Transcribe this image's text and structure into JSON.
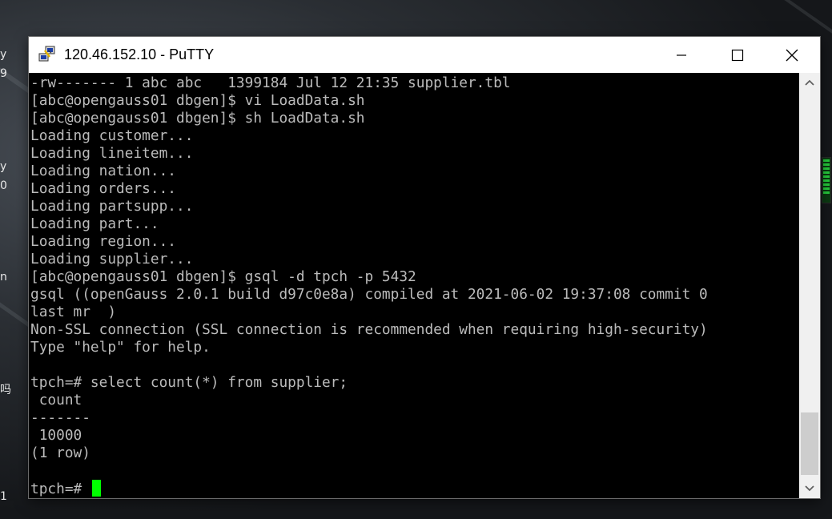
{
  "window": {
    "title": "120.46.152.10 - PuTTY",
    "app_icon": "putty-icon",
    "controls": {
      "minimize": "minimize-icon",
      "maximize": "maximize-icon",
      "close": "close-icon"
    }
  },
  "terminal": {
    "lines": [
      "-rw------- 1 abc abc   1399184 Jul 12 21:35 supplier.tbl",
      "[abc@opengauss01 dbgen]$ vi LoadData.sh",
      "[abc@opengauss01 dbgen]$ sh LoadData.sh",
      "Loading customer...",
      "Loading lineitem...",
      "Loading nation...",
      "Loading orders...",
      "Loading partsupp...",
      "Loading part...",
      "Loading region...",
      "Loading supplier...",
      "[abc@opengauss01 dbgen]$ gsql -d tpch -p 5432",
      "gsql ((openGauss 2.0.1 build d97c0e8a) compiled at 2021-06-02 19:37:08 commit 0",
      "last mr  )",
      "Non-SSL connection (SSL connection is recommended when requiring high-security)",
      "Type \"help\" for help.",
      "",
      "tpch=# select count(*) from supplier;",
      " count",
      "-------",
      " 10000",
      "(1 row)",
      ""
    ],
    "prompt": "tpch=# ",
    "cursor_color": "#00ff00",
    "text_color": "#bbbbbb",
    "background": "#000000"
  },
  "scrollbar": {
    "up_icon": "chevron-up-icon",
    "down_icon": "chevron-down-icon",
    "position": 0.95
  },
  "desktop": {
    "edge_chars": [
      "y",
      "9",
      "y",
      "0",
      "n",
      "吗",
      "1"
    ]
  }
}
